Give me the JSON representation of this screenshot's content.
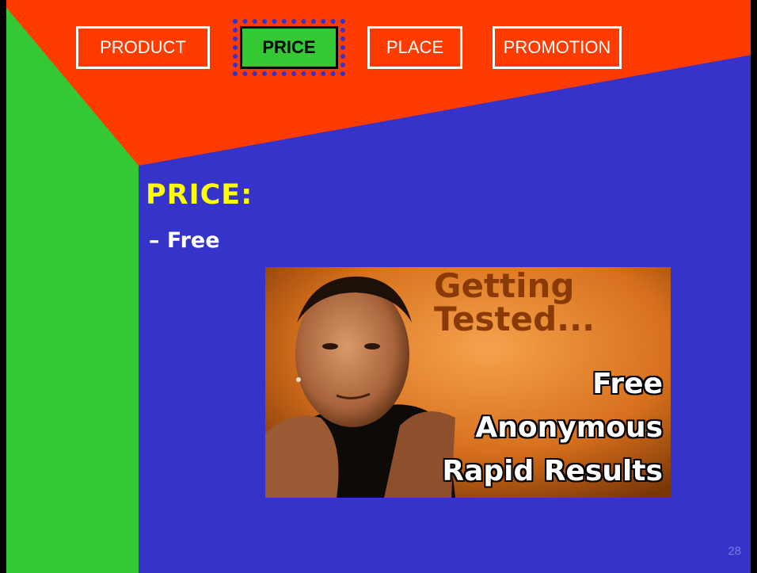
{
  "nav": {
    "items": [
      {
        "label": "PRODUCT",
        "active": false
      },
      {
        "label": "PRICE",
        "active": true
      },
      {
        "label": "PLACE",
        "active": false
      },
      {
        "label": "PROMOTION",
        "active": false
      }
    ]
  },
  "content": {
    "heading": "PRICE:",
    "bullet": "– Free"
  },
  "ad": {
    "line1": "Getting",
    "line2": "Tested...",
    "line3": "Free",
    "line4": "Anonymous",
    "line5": "Rapid Results"
  },
  "footer": {
    "page_number": "28"
  },
  "colors": {
    "background": "#3533c9",
    "red": "#ff3b00",
    "green": "#34c934",
    "heading": "#ffff00"
  }
}
